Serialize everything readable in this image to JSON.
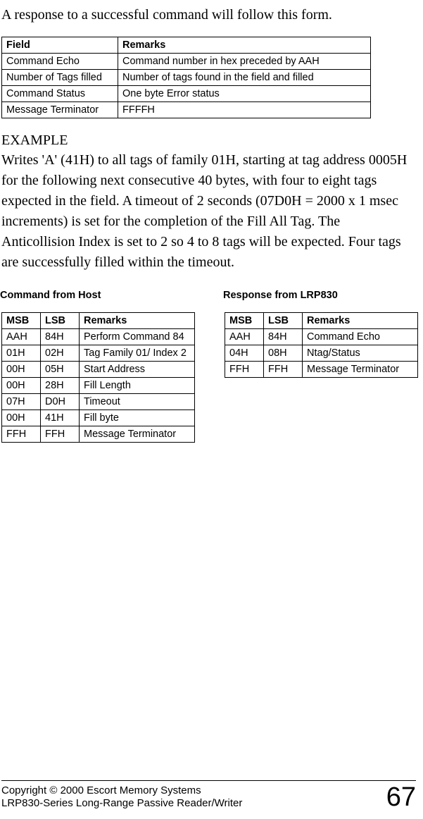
{
  "intro": "A response to a successful command will follow this form.",
  "fieldsTable": {
    "headers": [
      "Field",
      "Remarks"
    ],
    "rows": [
      [
        "Command Echo",
        "Command number in hex preceded by AAH"
      ],
      [
        "Number of Tags filled",
        "Number of tags found in the field and filled"
      ],
      [
        "Command Status",
        "One byte Error status"
      ],
      [
        "Message Terminator",
        "FFFFH"
      ]
    ]
  },
  "example": {
    "heading": "EXAMPLE",
    "body": "Writes 'A' (41H) to all tags of family 01H, starting at tag address 0005H for the following next consecutive 40 bytes, with four to eight tags expected in the field.  A timeout of 2 seconds (07D0H = 2000 x 1 msec increments) is set for the completion of the Fill All Tag. The Anticollision Index is set to 2 so 4 to 8 tags will be expected.  Four tags are successfully filled within the timeout."
  },
  "leftTable": {
    "title": "Command from Host",
    "headers": [
      "MSB",
      "LSB",
      "Remarks"
    ],
    "rows": [
      [
        "AAH",
        "84H",
        "Perform Command 84"
      ],
      [
        "01H",
        "02H",
        "Tag Family 01/ Index 2"
      ],
      [
        "00H",
        "05H",
        "Start Address"
      ],
      [
        "00H",
        "28H",
        "Fill Length"
      ],
      [
        "07H",
        "D0H",
        "Timeout"
      ],
      [
        "00H",
        "41H",
        "Fill byte"
      ],
      [
        "FFH",
        "FFH",
        "Message Terminator"
      ]
    ]
  },
  "rightTable": {
    "title": "Response from LRP830",
    "headers": [
      "MSB",
      "LSB",
      "Remarks"
    ],
    "rows": [
      [
        "AAH",
        "84H",
        "Command Echo"
      ],
      [
        "04H",
        "08H",
        "Ntag/Status"
      ],
      [
        "FFH",
        "FFH",
        "Message Terminator"
      ]
    ]
  },
  "footer": {
    "line1": "Copyright © 2000 Escort Memory Systems",
    "line2": "LRP830-Series Long-Range Passive Reader/Writer",
    "page": "67"
  }
}
